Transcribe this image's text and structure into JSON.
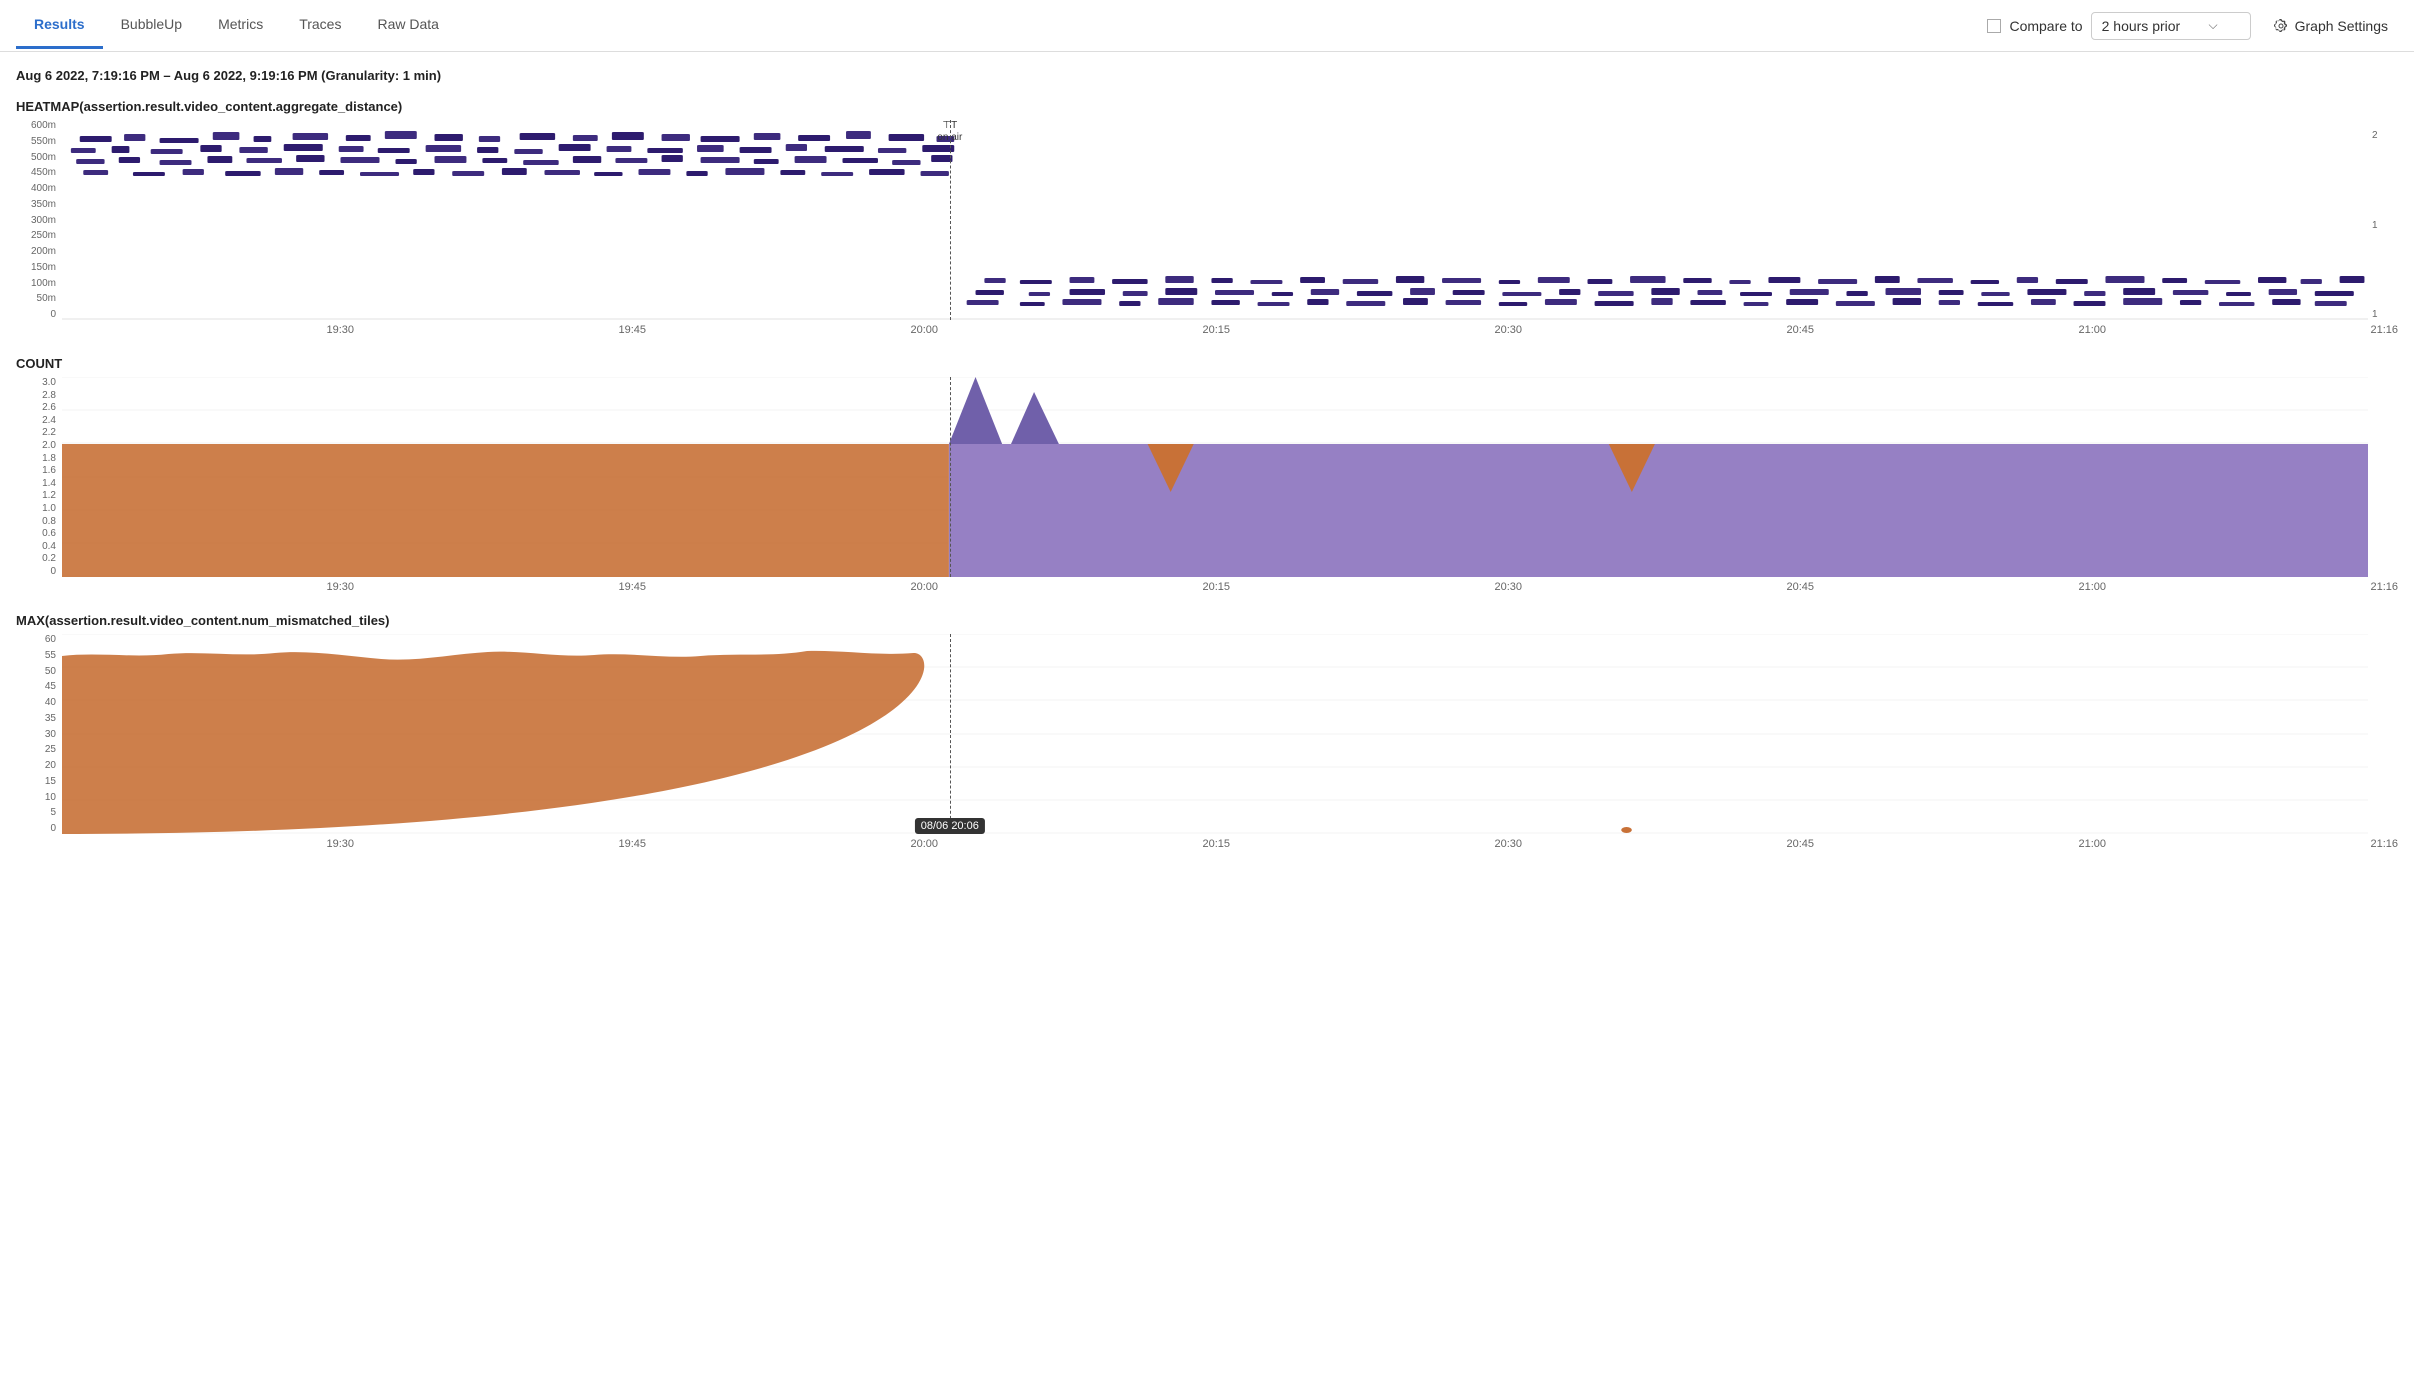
{
  "nav": {
    "tabs": [
      {
        "label": "Results",
        "active": true
      },
      {
        "label": "BubbleUp",
        "active": false
      },
      {
        "label": "Metrics",
        "active": false
      },
      {
        "label": "Traces",
        "active": false
      },
      {
        "label": "Raw Data",
        "active": false
      }
    ],
    "compare_to_label": "Compare to",
    "compare_value": "2 hours prior",
    "graph_settings_label": "Graph Settings"
  },
  "header": {
    "date_range": "Aug 6 2022, 7:19:16 PM – Aug 6 2022, 9:19:16 PM (Granularity: 1 min)"
  },
  "heatmap": {
    "title": "HEATMAP(assertion.result.video_content.aggregate_distance)",
    "y_labels": [
      "600m",
      "550m",
      "500m",
      "450m",
      "400m",
      "350m",
      "300m",
      "250m",
      "200m",
      "150m",
      "100m",
      "50m",
      "0"
    ]
  },
  "count": {
    "title": "COUNT",
    "y_labels": [
      "3.0",
      "2.8",
      "2.6",
      "2.4",
      "2.2",
      "2.0",
      "1.8",
      "1.6",
      "1.4",
      "1.2",
      "1.0",
      "0.8",
      "0.6",
      "0.4",
      "0.2",
      "0"
    ]
  },
  "max": {
    "title": "MAX(assertion.result.video_content.num_mismatched_tiles)",
    "y_labels": [
      "60",
      "55",
      "50",
      "45",
      "40",
      "35",
      "30",
      "25",
      "20",
      "15",
      "10",
      "5",
      "0"
    ]
  },
  "x_axis_labels": [
    "19:30",
    "19:45",
    "20:00",
    "20:15",
    "20:30",
    "20:45",
    "21:00",
    "21:16"
  ],
  "marker": {
    "time": "08/06 20:06",
    "on_air_label": "on air"
  },
  "colors": {
    "orange": "#c87137",
    "purple": "#8b72be",
    "dark_purple": "#3d2b6e",
    "dashed_line": "#444"
  }
}
